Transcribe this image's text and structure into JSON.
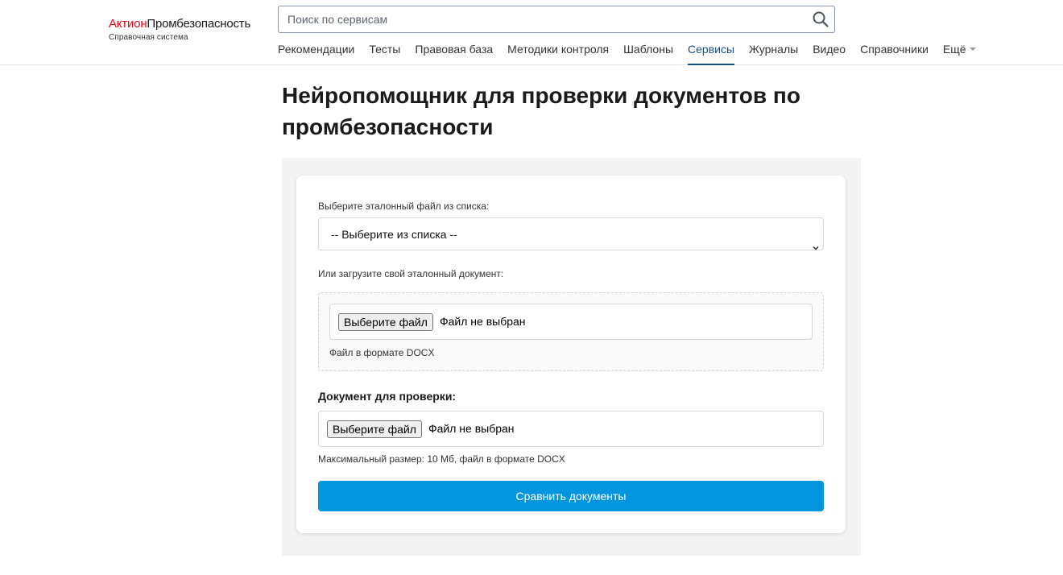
{
  "header": {
    "logo": {
      "brand": "Актион",
      "name": "Промбезопасность",
      "subtitle": "Справочная система"
    },
    "search": {
      "placeholder": "Поиск по сервисам",
      "icon": "search-icon"
    },
    "nav": {
      "items": [
        {
          "label": "Рекомендации"
        },
        {
          "label": "Тесты"
        },
        {
          "label": "Правовая база"
        },
        {
          "label": "Методики контроля"
        },
        {
          "label": "Шаблоны"
        },
        {
          "label": "Сервисы",
          "active": true
        },
        {
          "label": "Журналы"
        },
        {
          "label": "Видео"
        },
        {
          "label": "Справочники"
        },
        {
          "label": "Ещё"
        }
      ]
    }
  },
  "main": {
    "title": "Нейропомощник для проверки документов по промбезопасности",
    "form": {
      "reference_select": {
        "label": "Выберите эталонный файл из списка:",
        "selected": "-- Выберите из списка --"
      },
      "reference_upload": {
        "label": "Или загрузите свой эталонный документ:",
        "button": "Выберите файл",
        "status": "Файл не выбран",
        "hint": "Файл в формате DOCX"
      },
      "check_document": {
        "label": "Документ для проверки:",
        "button": "Выберите файл",
        "status": "Файл не выбран",
        "hint": "Максимальный размер: 10 Мб, файл в формате DOCX"
      },
      "submit_label": "Сравнить документы"
    }
  },
  "colors": {
    "brand_red": "#e30613",
    "nav_active": "#1a4e8a",
    "primary_button": "#0396de",
    "panel_bg": "#f3f3f3"
  }
}
